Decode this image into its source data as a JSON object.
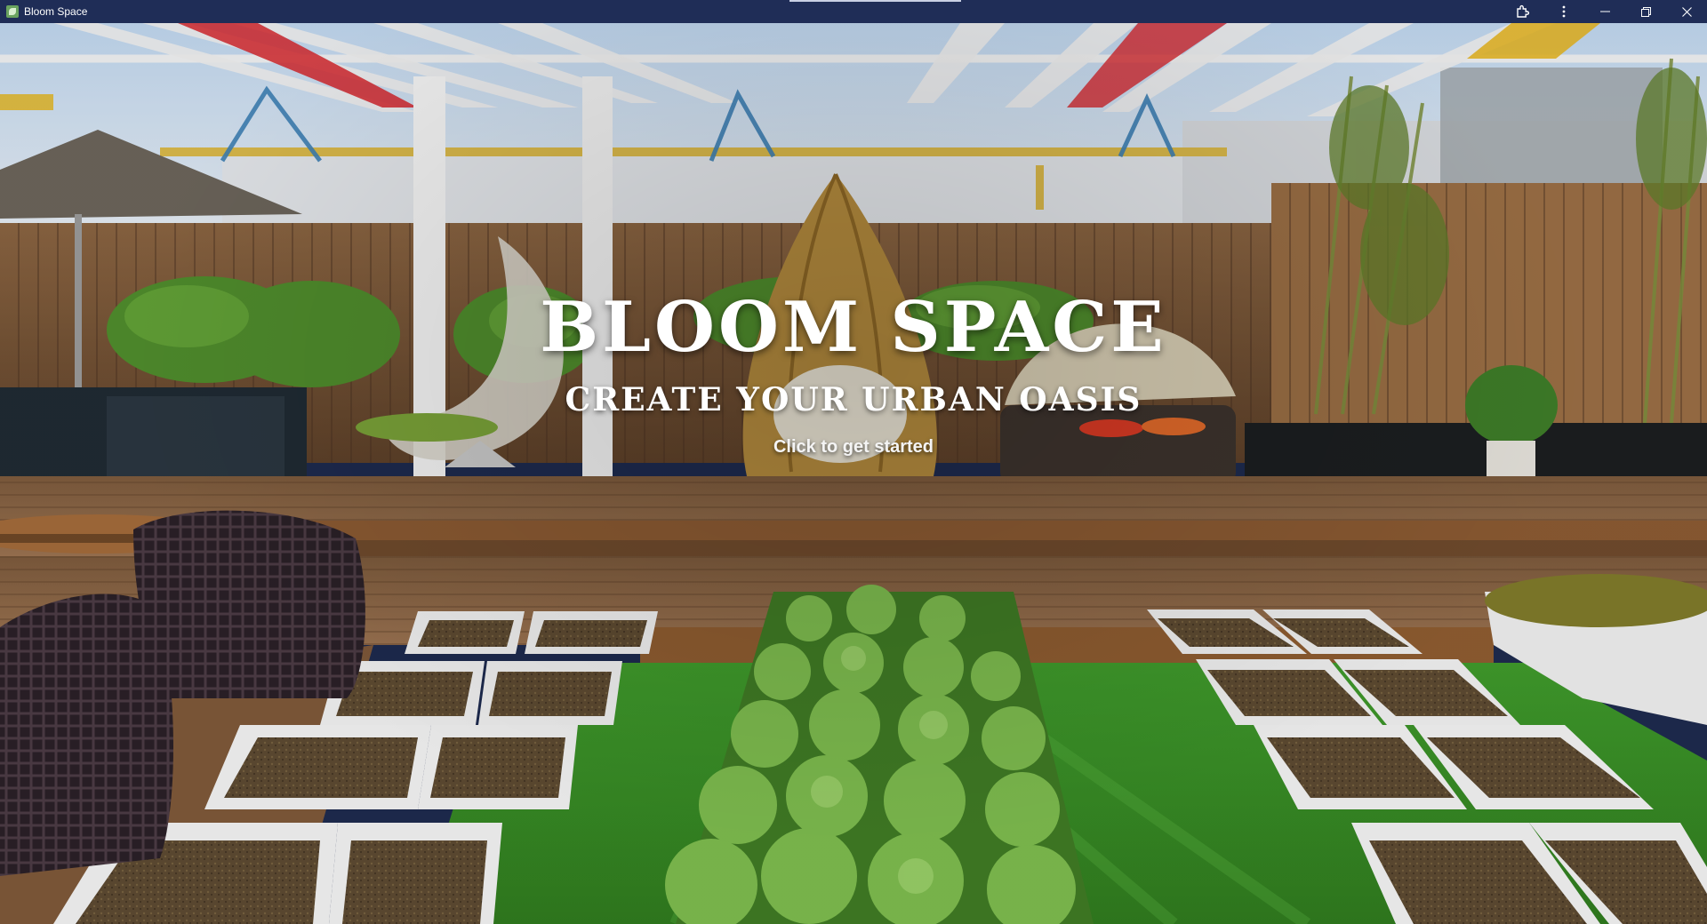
{
  "window": {
    "title": "Bloom Space",
    "app_icon": "bloom-leaf-icon",
    "controls": [
      "extensions-icon",
      "more-options-icon",
      "minimize-icon",
      "restore-icon",
      "close-icon"
    ]
  },
  "hero": {
    "title": "BLOOM SPACE",
    "subtitle": "CREATE YOUR URBAN OASIS",
    "cta": "Click to get started",
    "background": "rooftop garden with pergola, wooden deck, raised planter beds and artificial grass"
  },
  "colors": {
    "titlebar": "#1f2d57",
    "text": "#ffffff",
    "deck": "#7a5a3d",
    "grass": "#3f8f2a",
    "planter": "#eeeeee"
  }
}
